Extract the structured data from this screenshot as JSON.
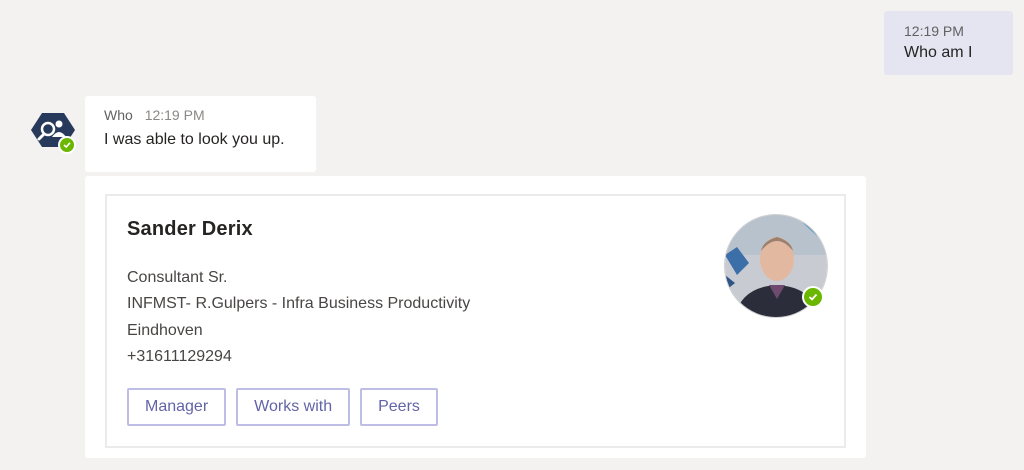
{
  "outgoing_message": {
    "time": "12:19 PM",
    "text": "Who am I"
  },
  "incoming_message": {
    "sender": "Who",
    "time": "12:19 PM",
    "text": "I was able to look you up."
  },
  "profile_card": {
    "name": "Sander Derix",
    "title": "Consultant Sr.",
    "department": "INFMST- R.Gulpers - Infra Business Productivity",
    "location": "Eindhoven",
    "phone": "+31611129294",
    "presence": "available",
    "actions": [
      "Manager",
      "Works with",
      "Peers"
    ]
  },
  "colors": {
    "background": "#f3f2f1",
    "outgoing_bubble": "#e5e5f1",
    "accent": "#6264a7",
    "presence_available": "#6bb700",
    "bot_avatar": "#283a5c"
  }
}
